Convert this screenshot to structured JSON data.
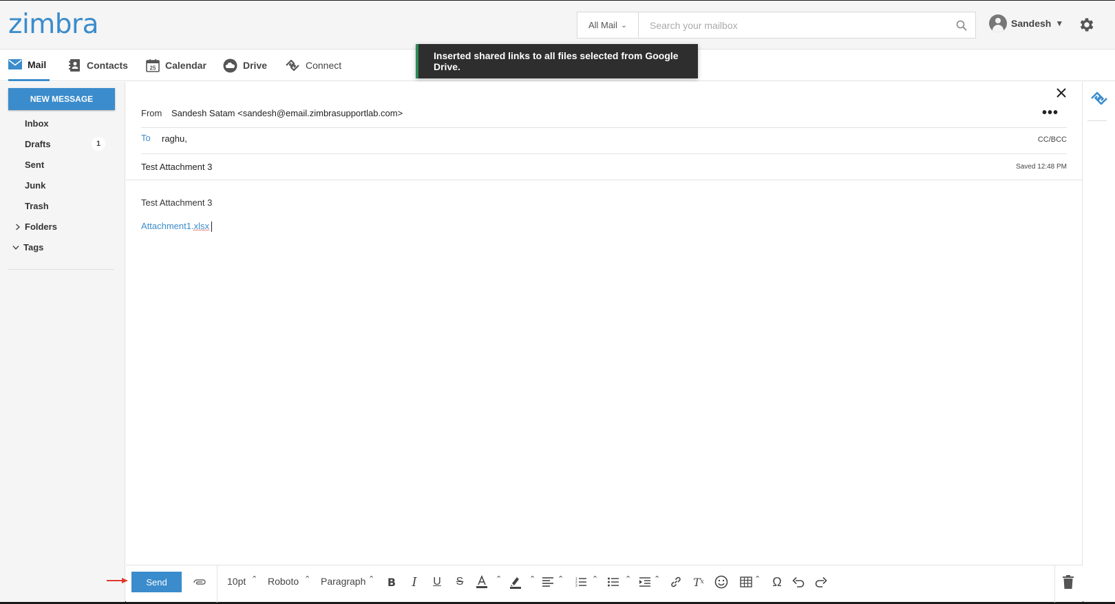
{
  "app": {
    "logo": "zimbra"
  },
  "header": {
    "search_scope": "All Mail",
    "search_placeholder": "Search your mailbox",
    "user_name": "Sandesh"
  },
  "nav": {
    "items": [
      {
        "label": "Mail",
        "icon": "mail-icon",
        "active": true
      },
      {
        "label": "Contacts",
        "icon": "contacts-icon"
      },
      {
        "label": "Calendar",
        "icon": "calendar-icon",
        "day": "25"
      },
      {
        "label": "Drive",
        "icon": "cloud-icon"
      },
      {
        "label": "Connect",
        "icon": "connect-icon"
      }
    ]
  },
  "toast": {
    "message": "Inserted shared links to all files selected from Google Drive."
  },
  "sidebar": {
    "new_message": "NEW MESSAGE",
    "folders": [
      {
        "label": "Inbox"
      },
      {
        "label": "Drafts",
        "count": "1"
      },
      {
        "label": "Sent"
      },
      {
        "label": "Junk"
      },
      {
        "label": "Trash"
      }
    ],
    "folders_group": "Folders",
    "tags_group": "Tags"
  },
  "compose": {
    "from_label": "From",
    "from_value": "Sandesh Satam <sandesh@email.zimbrasupportlab.com>",
    "to_label": "To",
    "to_value": "raghu,",
    "cc_bcc": "CC/BCC",
    "subject": "Test Attachment 3",
    "saved": "Saved 12:48 PM",
    "body_text": "Test Attachment 3",
    "link_name": "Attachment1.",
    "link_ext": "xlsx"
  },
  "toolbar": {
    "send": "Send",
    "font_size": "10pt",
    "font_family": "Roboto",
    "block_format": "Paragraph"
  },
  "colors": {
    "accent": "#3b8ccc",
    "toast_bg": "#2e2e2e",
    "toast_accent": "#2e8b57",
    "arrow": "#e0392b"
  }
}
